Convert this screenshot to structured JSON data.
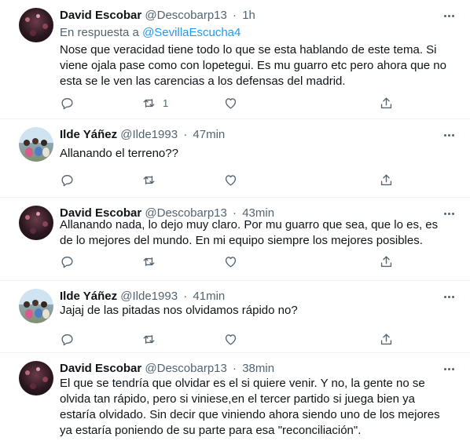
{
  "tweets": [
    {
      "name": "David Escobar",
      "handle": "@Descobarp13",
      "sep": "·",
      "time": "1h",
      "reply_prefix": "En respuesta a",
      "reply_mention": "@SevillaEscucha4",
      "text": "Nose que veracidad tiene todo lo que se esta hablando de este tema. Si viene ojala pase como con lopetegui. Es mu guarro etc pero ahora que no esta se le ven las carencias a los defensas del madrid.",
      "retweets": "1"
    },
    {
      "name": "Ilde Yáñez",
      "handle": "@Ilde1993",
      "sep": "·",
      "time": "47min",
      "text": "Allanando el terreno??"
    },
    {
      "name": "David Escobar",
      "handle": "@Descobarp13",
      "sep": "·",
      "time": "43min",
      "text": "Allanando nada, lo dejo muy claro. Por mu guarro que sea, que lo es, es de lo mejores del mundo. En mi equipo siempre los mejores posibles."
    },
    {
      "name": "Ilde Yáñez",
      "handle": "@Ilde1993",
      "sep": "·",
      "time": "41min",
      "text": "Jajaj de las pitadas nos olvidamos rápido no?"
    },
    {
      "name": "David Escobar",
      "handle": "@Descobarp13",
      "sep": "·",
      "time": "38min",
      "text": "El que se tendría que olvidar es el si quiere venir. Y no, la gente no se olvida tan rápido, pero si viniese,en el tercer partido si juega bien ya estaría olvidado. Sin decir que viniendo ahora siendo uno de los mejores ya estaría poniendo de su parte para esa \"reconciliación\"."
    }
  ],
  "icons": {
    "reply": "reply-icon",
    "retweet": "retweet-icon",
    "like": "heart-icon",
    "share": "share-icon",
    "more": "more-icon"
  },
  "colors": {
    "text": "#0f1419",
    "secondary": "#536471",
    "link": "#1d9bf0",
    "divider": "#eff3f4"
  }
}
